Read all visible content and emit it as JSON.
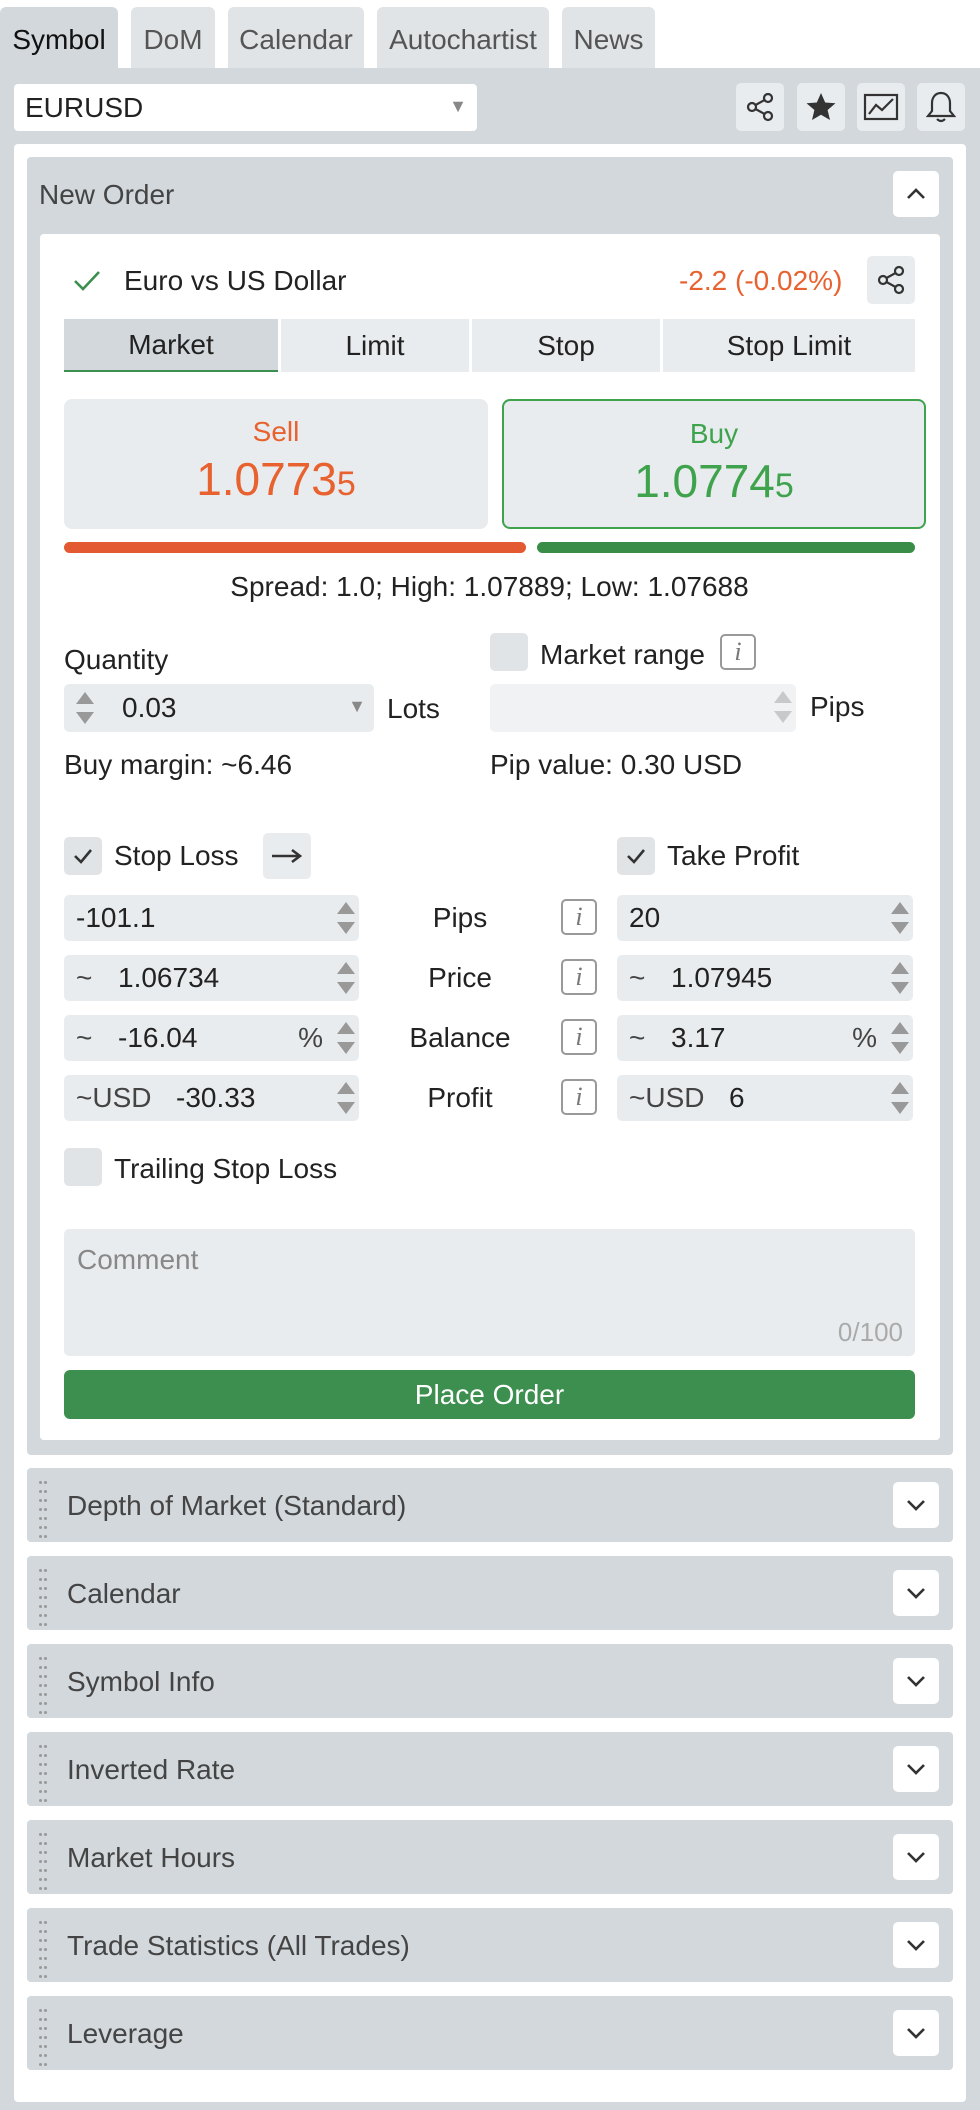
{
  "tabs": [
    {
      "label": "Symbol",
      "active": true
    },
    {
      "label": "DoM",
      "active": false
    },
    {
      "label": "Calendar",
      "active": false
    },
    {
      "label": "Autochartist",
      "active": false
    },
    {
      "label": "News",
      "active": false
    }
  ],
  "symbol": "EURUSD",
  "new_order": {
    "title": "New Order",
    "instrument": "Euro vs US Dollar",
    "change": "-2.2 (-0.02%)",
    "order_types": [
      "Market",
      "Limit",
      "Stop",
      "Stop Limit"
    ],
    "selected_order_type": "Market",
    "sell": {
      "label": "Sell",
      "price_main": "1.0773",
      "price_pip": "5"
    },
    "buy": {
      "label": "Buy",
      "price_main": "1.0774",
      "price_pip": "5"
    },
    "stats": "Spread: 1.0; High: 1.07889; Low: 1.07688",
    "quantity_label": "Quantity",
    "quantity_value": "0.03",
    "quantity_unit": "Lots",
    "market_range_label": "Market range",
    "pips_unit": "Pips",
    "buy_margin": "Buy margin: ~6.46",
    "pip_value": "Pip value: 0.30 USD",
    "stop_loss_label": "Stop Loss",
    "take_profit_label": "Take Profit",
    "rows": [
      {
        "label": "Pips",
        "sl_prefix": "",
        "sl_value": "-101.1",
        "sl_suffix": "",
        "tp_prefix": "",
        "tp_value": "20",
        "tp_suffix": ""
      },
      {
        "label": "Price",
        "sl_prefix": "~",
        "sl_value": "1.06734",
        "sl_suffix": "",
        "tp_prefix": "~",
        "tp_value": "1.07945",
        "tp_suffix": ""
      },
      {
        "label": "Balance",
        "sl_prefix": "~",
        "sl_value": "-16.04",
        "sl_suffix": "%",
        "tp_prefix": "~",
        "tp_value": "3.17",
        "tp_suffix": "%"
      },
      {
        "label": "Profit",
        "sl_prefix": "~USD",
        "sl_value": "-30.33",
        "sl_suffix": "",
        "tp_prefix": "~USD",
        "tp_value": "6",
        "tp_suffix": ""
      }
    ],
    "trailing_stop_label": "Trailing Stop Loss",
    "comment_placeholder": "Comment",
    "comment_counter": "0/100",
    "place_order_label": "Place Order"
  },
  "sections": [
    "Depth of Market (Standard)",
    "Calendar",
    "Symbol Info",
    "Inverted Rate",
    "Market Hours",
    "Trade Statistics (All Trades)",
    "Leverage"
  ],
  "colors": {
    "sell": "#e8622f",
    "buy": "#3fa34d",
    "accent_green": "#3d8f4f",
    "panel": "#d3d8dc"
  }
}
